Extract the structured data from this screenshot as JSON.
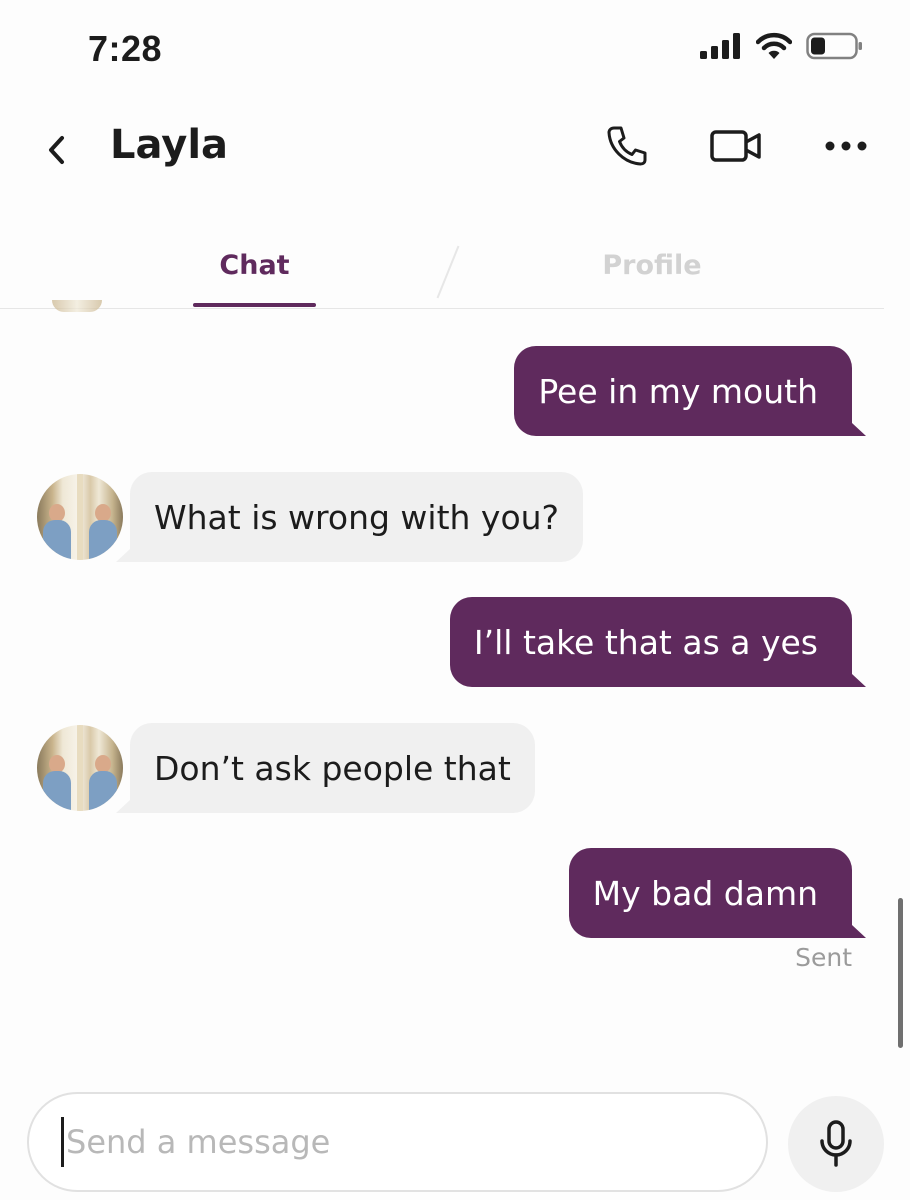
{
  "status_bar": {
    "time": "7:28"
  },
  "header": {
    "title": "Layla"
  },
  "tabs": [
    {
      "label": "Chat",
      "active": true
    },
    {
      "label": "Profile",
      "active": false
    }
  ],
  "messages": [
    {
      "direction": "outgoing",
      "text": "Pee in my mouth"
    },
    {
      "direction": "incoming",
      "text": "What is wrong with you?"
    },
    {
      "direction": "outgoing",
      "text": "I’ll take that as a yes"
    },
    {
      "direction": "incoming",
      "text": "Don’t ask people that"
    },
    {
      "direction": "outgoing",
      "text": "My bad damn"
    }
  ],
  "delivery_status": "Sent",
  "composer": {
    "placeholder": "Send a message",
    "value": ""
  },
  "colors": {
    "accent": "#5f2a5d",
    "incoming_bubble": "#f0f0f0",
    "inactive_tab": "#d2d2d2",
    "meta_text": "#9b9b9b"
  },
  "icons": [
    "back-chevron-icon",
    "phone-icon",
    "video-camera-icon",
    "more-icon",
    "signal-icon",
    "wifi-icon",
    "battery-icon",
    "microphone-icon"
  ]
}
